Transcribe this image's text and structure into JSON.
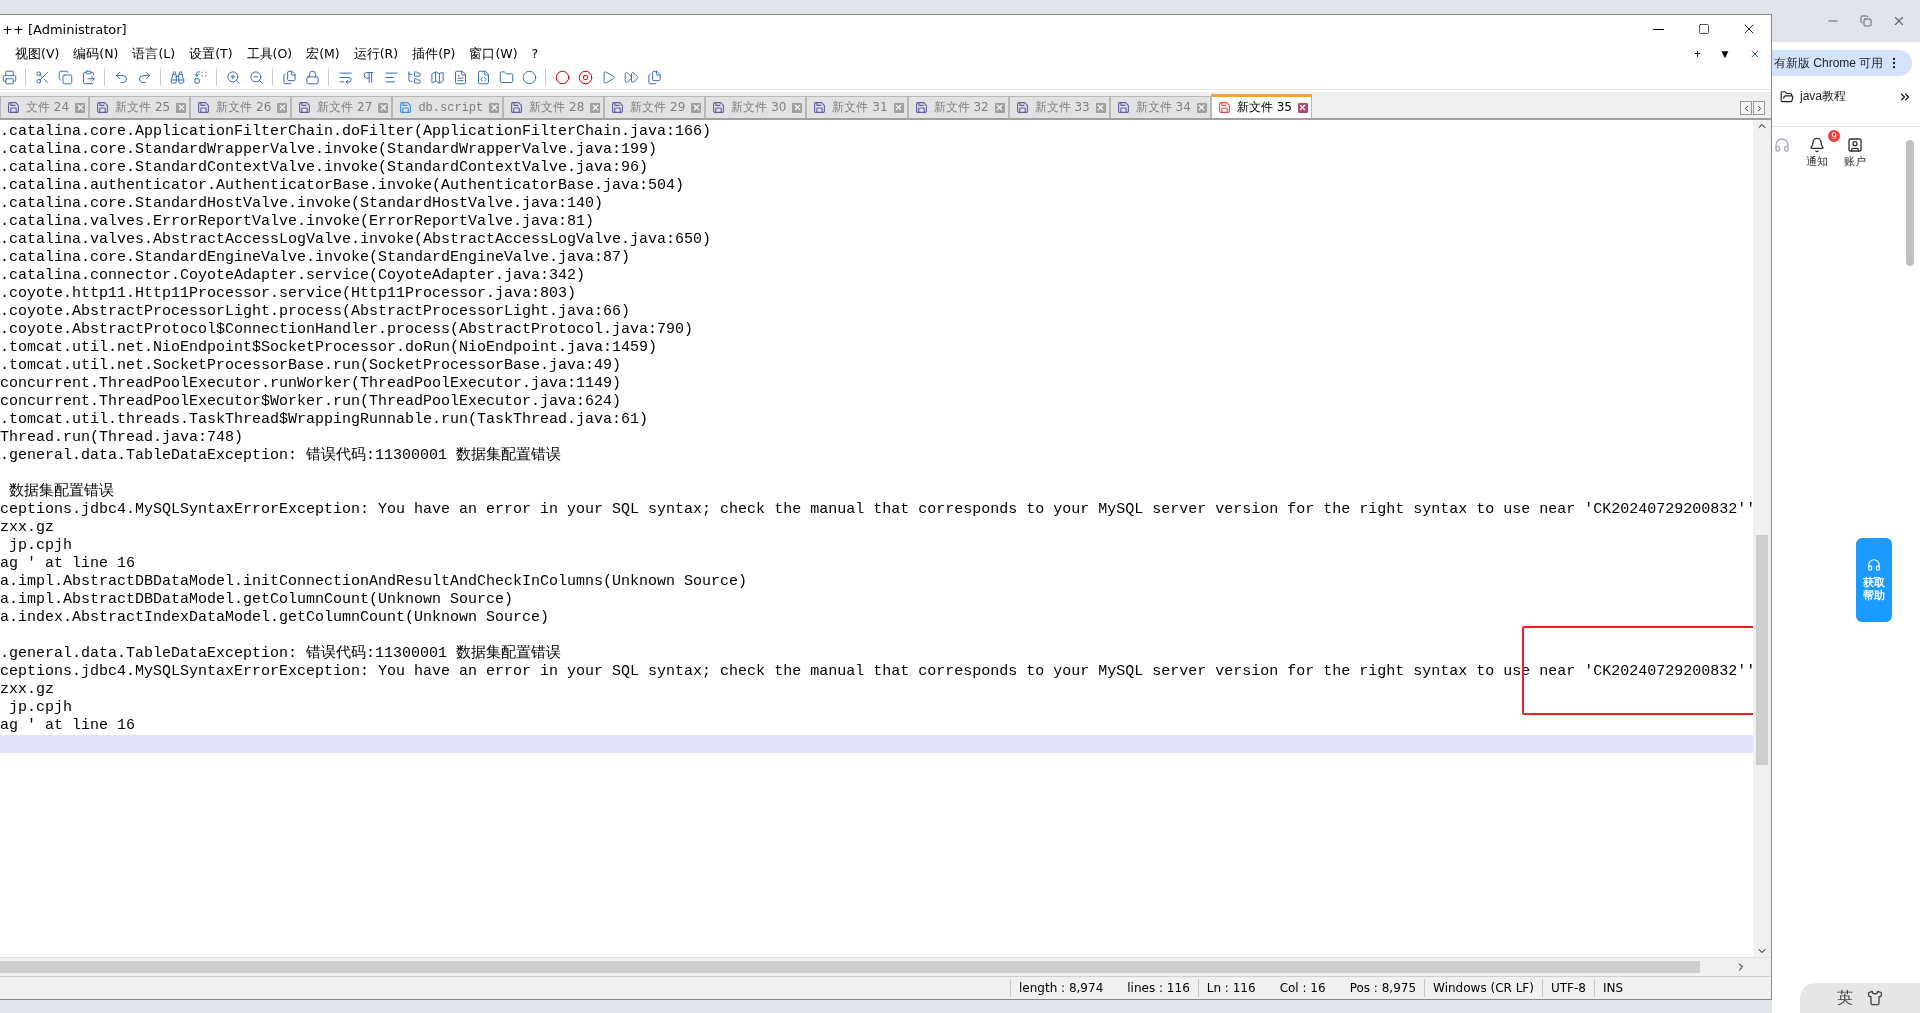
{
  "window": {
    "title": "++ [Administrator]",
    "extra_controls": [
      "+",
      "▼"
    ]
  },
  "menu": [
    "视图(V)",
    "编码(N)",
    "语言(L)",
    "设置(T)",
    "工具(O)",
    "宏(M)",
    "运行(R)",
    "插件(P)",
    "窗口(W)",
    "?"
  ],
  "tabs": [
    {
      "label": "文件 24",
      "kind": "file",
      "selected": false
    },
    {
      "label": "新文件 25",
      "kind": "file",
      "selected": false
    },
    {
      "label": "新文件 26",
      "kind": "file",
      "selected": false
    },
    {
      "label": "新文件 27",
      "kind": "file",
      "selected": false
    },
    {
      "label": "db.script",
      "kind": "script",
      "selected": false
    },
    {
      "label": "新文件 28",
      "kind": "file",
      "selected": false
    },
    {
      "label": "新文件 29",
      "kind": "file",
      "selected": false
    },
    {
      "label": "新文件 30",
      "kind": "file",
      "selected": false
    },
    {
      "label": "新文件 31",
      "kind": "file",
      "selected": false
    },
    {
      "label": "新文件 32",
      "kind": "file",
      "selected": false
    },
    {
      "label": "新文件 33",
      "kind": "file",
      "selected": false
    },
    {
      "label": "新文件 34",
      "kind": "file",
      "selected": false
    },
    {
      "label": "新文件 35",
      "kind": "file",
      "selected": true
    }
  ],
  "editor": {
    "lines": [
      {
        "text": ".catalina.core.ApplicationFilterChain.doFilter(ApplicationFilterChain.java:166)",
        "current": false
      },
      {
        "text": ".catalina.core.StandardWrapperValve.invoke(StandardWrapperValve.java:199)",
        "current": false
      },
      {
        "text": ".catalina.core.StandardContextValve.invoke(StandardContextValve.java:96)",
        "current": false
      },
      {
        "text": ".catalina.authenticator.AuthenticatorBase.invoke(AuthenticatorBase.java:504)",
        "current": false
      },
      {
        "text": ".catalina.core.StandardHostValve.invoke(StandardHostValve.java:140)",
        "current": false
      },
      {
        "text": ".catalina.valves.ErrorReportValve.invoke(ErrorReportValve.java:81)",
        "current": false
      },
      {
        "text": ".catalina.valves.AbstractAccessLogValve.invoke(AbstractAccessLogValve.java:650)",
        "current": false
      },
      {
        "text": ".catalina.core.StandardEngineValve.invoke(StandardEngineValve.java:87)",
        "current": false
      },
      {
        "text": ".catalina.connector.CoyoteAdapter.service(CoyoteAdapter.java:342)",
        "current": false
      },
      {
        "text": ".coyote.http11.Http11Processor.service(Http11Processor.java:803)",
        "current": false
      },
      {
        "text": ".coyote.AbstractProcessorLight.process(AbstractProcessorLight.java:66)",
        "current": false
      },
      {
        "text": ".coyote.AbstractProtocol$ConnectionHandler.process(AbstractProtocol.java:790)",
        "current": false
      },
      {
        "text": ".tomcat.util.net.NioEndpoint$SocketProcessor.doRun(NioEndpoint.java:1459)",
        "current": false
      },
      {
        "text": ".tomcat.util.net.SocketProcessorBase.run(SocketProcessorBase.java:49)",
        "current": false
      },
      {
        "text": "concurrent.ThreadPoolExecutor.runWorker(ThreadPoolExecutor.java:1149)",
        "current": false
      },
      {
        "text": "concurrent.ThreadPoolExecutor$Worker.run(ThreadPoolExecutor.java:624)",
        "current": false
      },
      {
        "text": ".tomcat.util.threads.TaskThread$WrappingRunnable.run(TaskThread.java:61)",
        "current": false
      },
      {
        "text": "Thread.run(Thread.java:748)",
        "current": false
      },
      {
        "text": ".general.data.TableDataException: 错误代码:11300001 数据集配置错误",
        "current": false
      },
      {
        "current": false
      },
      {
        "text": " 数据集配置错误",
        "current": false
      },
      {
        "text": "ceptions.jdbc4.MySQLSyntaxErrorException: You have an error in your SQL syntax; check the manual that corresponds to your MySQL server version for the right syntax to use near 'CK20240729200832''",
        "current": false
      },
      {
        "text": "zxx.gz",
        "current": false
      },
      {
        "text": " jp.cpjh",
        "current": false
      },
      {
        "text": "ag ' at line 16",
        "current": false
      },
      {
        "text": "a.impl.AbstractDBDataModel.initConnectionAndResultAndCheckInColumns(Unknown Source)",
        "current": false
      },
      {
        "text": "a.impl.AbstractDBDataModel.getColumnCount(Unknown Source)",
        "current": false
      },
      {
        "text": "a.index.AbstractIndexDataModel.getColumnCount(Unknown Source)",
        "current": false
      },
      {
        "current": false
      },
      {
        "text": ".general.data.TableDataException: 错误代码:11300001 数据集配置错误",
        "current": false
      },
      {
        "text": "ceptions.jdbc4.MySQLSyntaxErrorException: You have an error in your SQL syntax; check the manual that corresponds to your MySQL server version for the right syntax to use near 'CK20240729200832''",
        "current": false
      },
      {
        "text": "zxx.gz",
        "current": false
      },
      {
        "text": " jp.cpjh",
        "current": false
      },
      {
        "text": "ag ' at line 16",
        "current": false
      },
      {
        "current": true
      }
    ]
  },
  "status_bar": [
    [
      "length : 8,974",
      "lines : 116"
    ],
    [
      "Ln : 116",
      "Col : 16",
      "Pos : 8,975"
    ],
    [
      "Windows (CR LF)"
    ],
    [
      "UTF-8"
    ],
    [
      "INS"
    ]
  ],
  "browser": {
    "update_pill": "有新版 Chrome 可用",
    "bookmark": "java教程",
    "notify_label": "通知",
    "notify_badge": "9",
    "account_label": "账户",
    "help_button": "获取帮助",
    "ime": "英"
  }
}
